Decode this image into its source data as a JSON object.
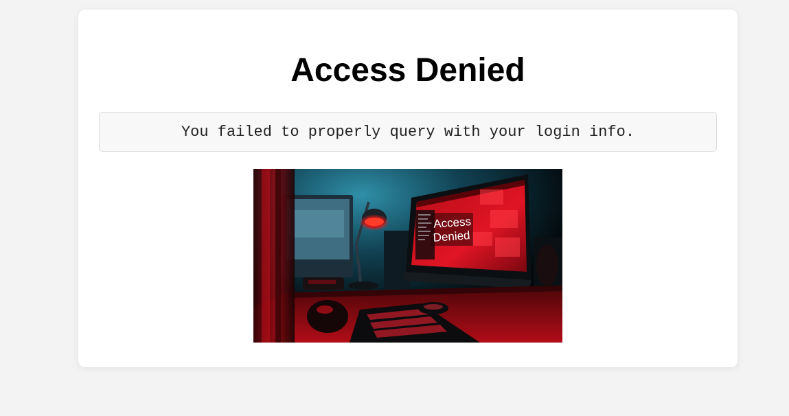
{
  "page": {
    "title": "Access Denied",
    "message": "You failed to properly query with your login info."
  },
  "image": {
    "screen_text_line1": "Access",
    "screen_text_line2": "Denied"
  },
  "colors": {
    "background": "#f3f3f3",
    "card": "#ffffff",
    "message_bg": "#f8f8f8",
    "accent_red": "#d10f1e"
  }
}
